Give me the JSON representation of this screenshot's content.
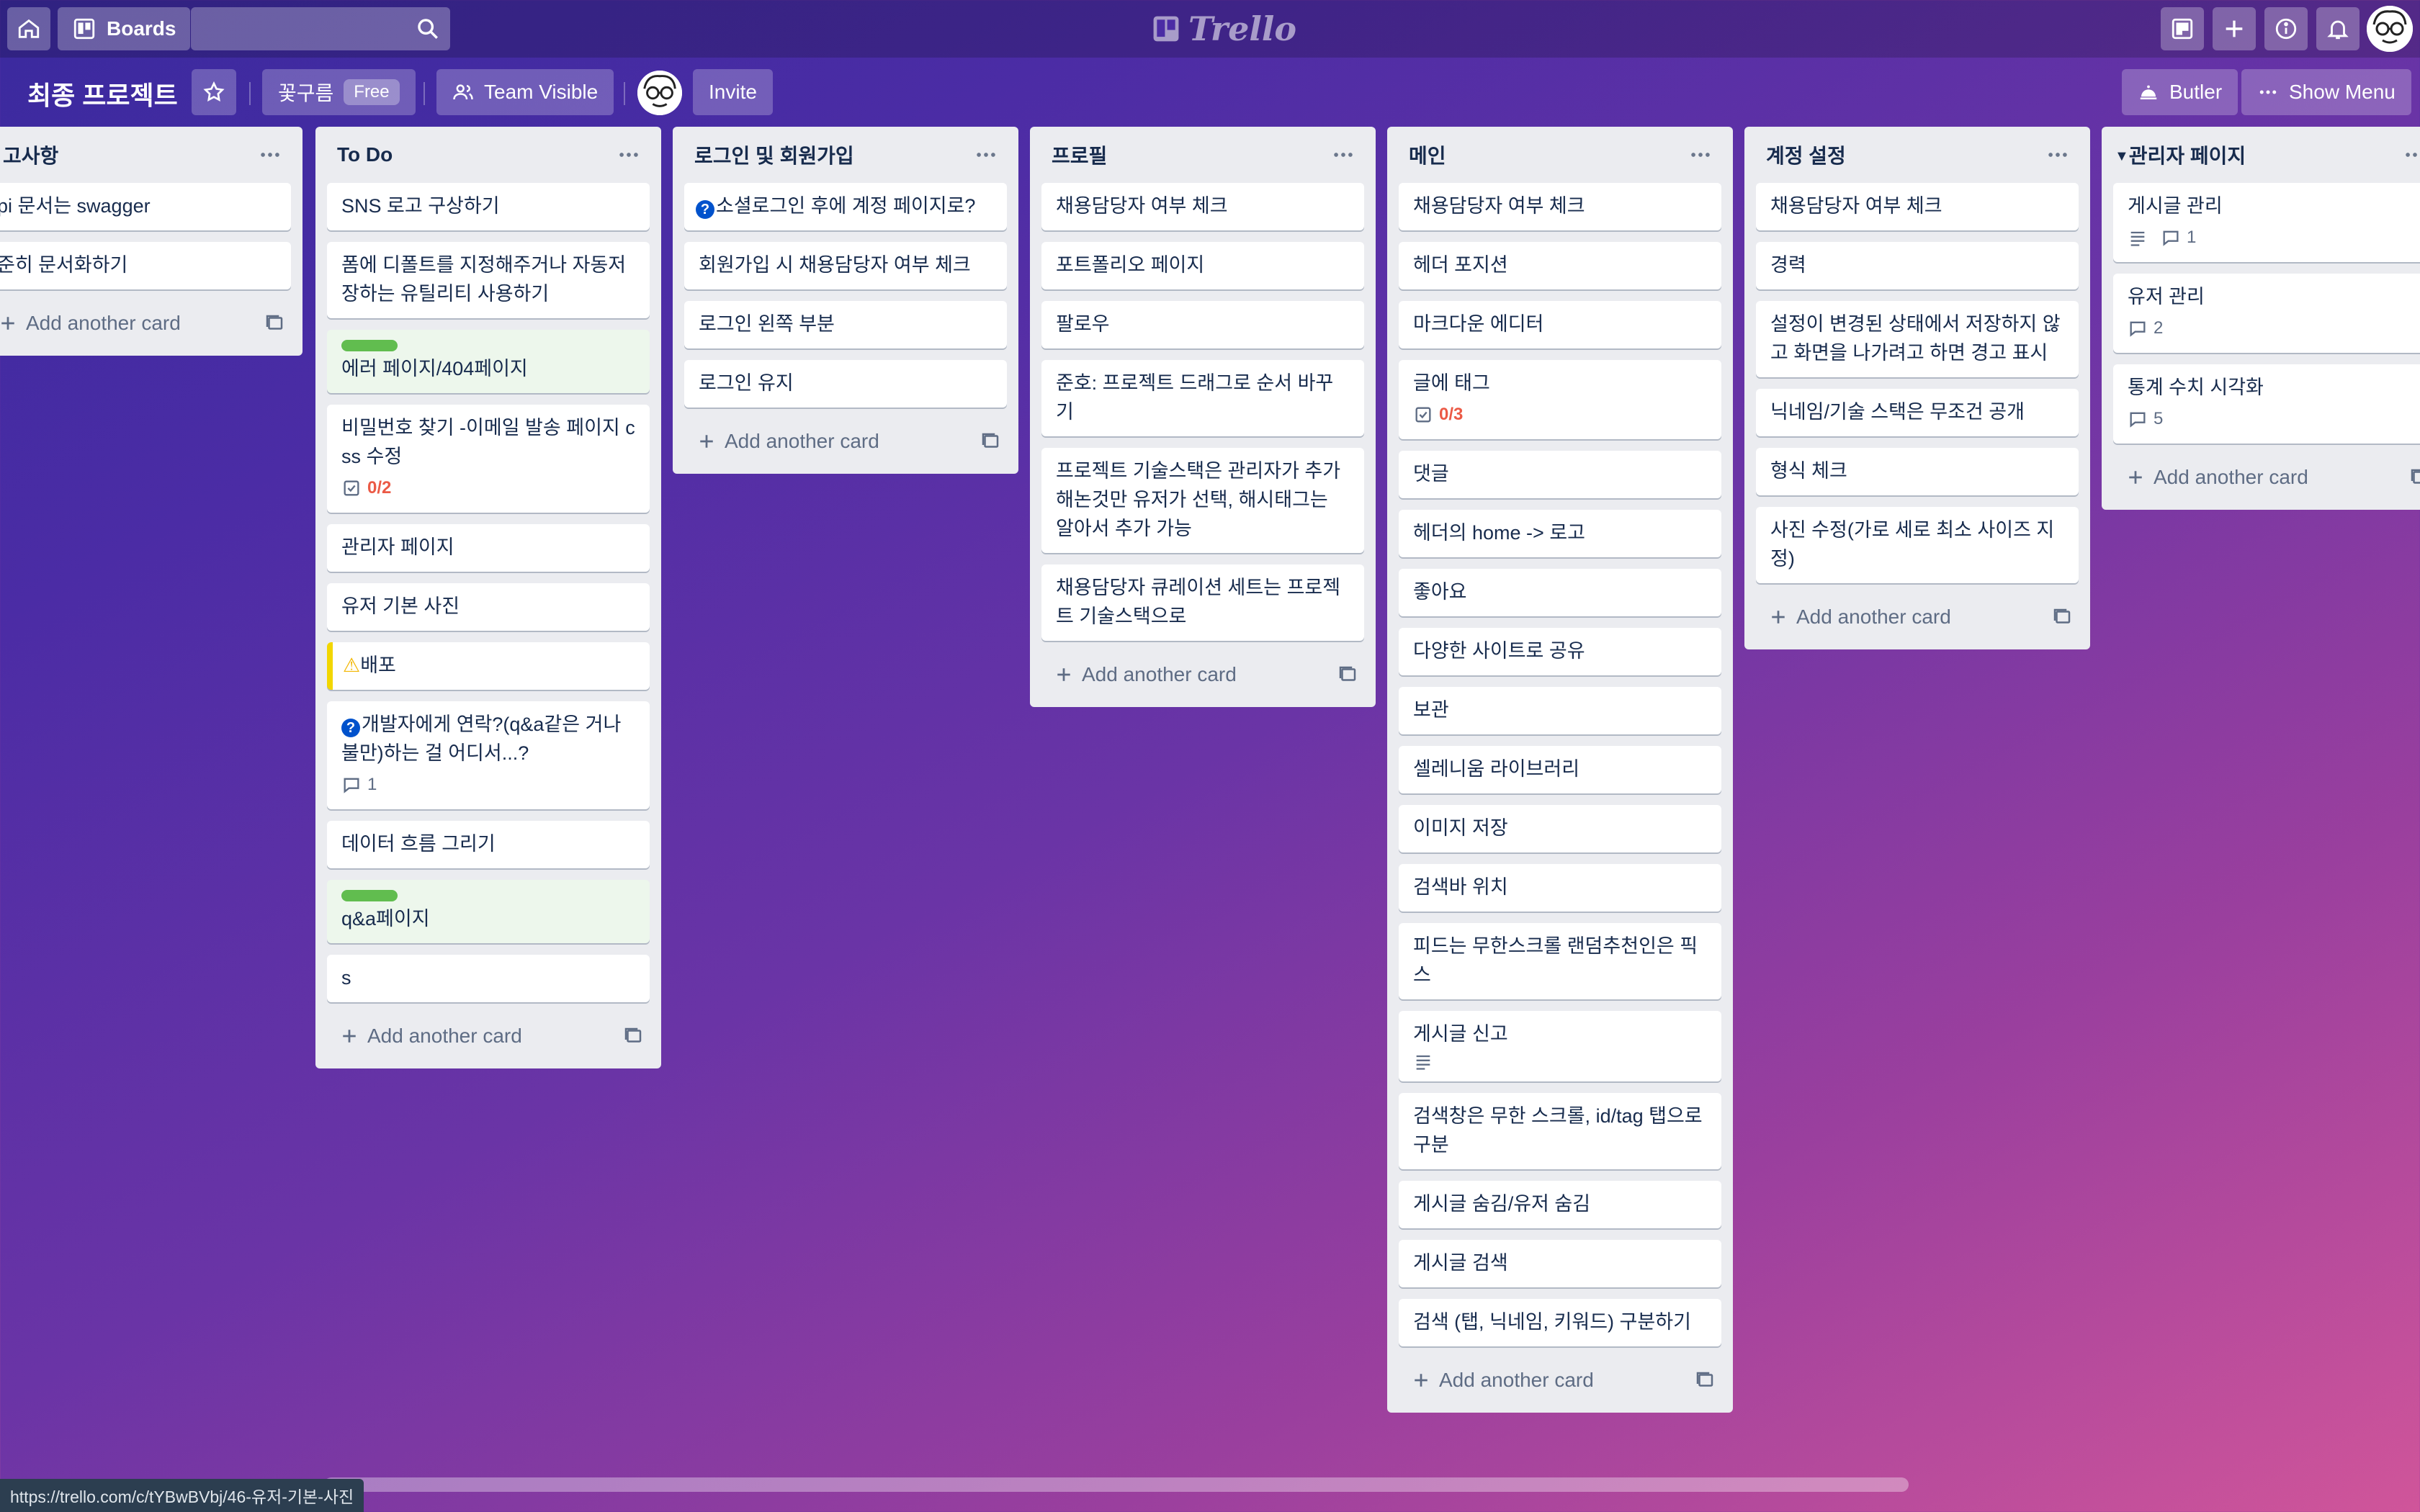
{
  "topbar": {
    "boards_label": "Boards",
    "search_placeholder": "",
    "logo_text": "Trello"
  },
  "board": {
    "title": "최종 프로젝트",
    "team_label": "꽃구름",
    "plan_badge": "Free",
    "visibility_label": "Team Visible",
    "invite_label": "Invite",
    "butler_label": "Butler",
    "show_menu_label": "Show Menu"
  },
  "add_card_label": "Add another card",
  "lists": [
    {
      "title": "고사항",
      "cards": [
        {
          "text": "pi 문서는 swagger"
        },
        {
          "text": "준히 문서화하기"
        }
      ]
    },
    {
      "title": "To Do",
      "cards": [
        {
          "text": "SNS 로고 구상하기"
        },
        {
          "text": "폼에 디폴트를 지정해주거나 자동저장하는 유틸리티 사용하기"
        },
        {
          "text": "에러 페이지/404페이지"
        },
        {
          "text": "비밀번호 찾기 -이메일 발송 페이지 css 수정",
          "checklist": "0/2"
        },
        {
          "text": "관리자 페이지"
        },
        {
          "text": "유저 기본 사진"
        },
        {
          "text": "배포"
        },
        {
          "text": "개발자에게 연락?(q&a같은 거나 불만)하는 걸 어디서...?",
          "comments": "1"
        },
        {
          "text": "데이터 흐름 그리기"
        },
        {
          "text": "q&a페이지"
        },
        {
          "text": "s"
        }
      ]
    },
    {
      "title": "로그인 및 회원가입",
      "cards": [
        {
          "text": "소셜로그인 후에 계정 페이지로?"
        },
        {
          "text": "회원가입 시 채용담당자 여부 체크"
        },
        {
          "text": "로그인 왼쪽 부분"
        },
        {
          "text": "로그인 유지"
        }
      ]
    },
    {
      "title": "프로필",
      "cards": [
        {
          "text": "채용담당자 여부 체크"
        },
        {
          "text": "포트폴리오 페이지"
        },
        {
          "text": "팔로우"
        },
        {
          "text": "준호: 프로젝트 드래그로 순서 바꾸기"
        },
        {
          "text": "프로젝트 기술스택은 관리자가 추가해논것만 유저가 선택, 해시태그는 알아서 추가 가능"
        },
        {
          "text": "채용담당자 큐레이션 세트는 프로젝트 기술스택으로"
        }
      ]
    },
    {
      "title": "메인",
      "cards": [
        {
          "text": "채용담당자 여부 체크"
        },
        {
          "text": "헤더 포지션"
        },
        {
          "text": "마크다운 에디터"
        },
        {
          "text": "글에 태그",
          "checklist": "0/3"
        },
        {
          "text": "댓글"
        },
        {
          "text": "헤더의 home -> 로고"
        },
        {
          "text": "좋아요"
        },
        {
          "text": "다양한 사이트로 공유"
        },
        {
          "text": "보관"
        },
        {
          "text": "셀레니움 라이브러리"
        },
        {
          "text": "이미지 저장"
        },
        {
          "text": "검색바 위치"
        },
        {
          "text": "피드는 무한스크롤 랜덤추천인은 픽스"
        },
        {
          "text": "게시글 신고"
        },
        {
          "text": "검색창은 무한 스크롤, id/tag 탭으로 구분"
        },
        {
          "text": "게시글 숨김/유저 숨김"
        },
        {
          "text": "게시글 검색"
        },
        {
          "text": "검색 (탭, 닉네임, 키워드) 구분하기"
        }
      ]
    },
    {
      "title": "계정 설정",
      "cards": [
        {
          "text": "채용담당자 여부 체크"
        },
        {
          "text": "경력"
        },
        {
          "text": "설정이 변경된 상태에서 저장하지 않고 화면을 나가려고 하면 경고 표시"
        },
        {
          "text": "닉네임/기술 스택은 무조건 공개"
        },
        {
          "text": "형식 체크"
        },
        {
          "text": "사진 수정(가로 세로 최소 사이즈 지정)"
        }
      ]
    },
    {
      "title": "관리자 페이지",
      "cards": [
        {
          "text": "게시글 관리",
          "comments": "1"
        },
        {
          "text": "유저 관리",
          "comments": "2"
        },
        {
          "text": "통계 수치 시각화",
          "comments": "5"
        }
      ]
    }
  ],
  "status_url": "https://trello.com/c/tYBwBVbj/46-유저-기본-사진",
  "colors": {
    "green_label": "#61bd4f",
    "yellow_label": "#f2d600",
    "overdue_red": "#eb5a46",
    "list_bg": "#ebecf0"
  }
}
